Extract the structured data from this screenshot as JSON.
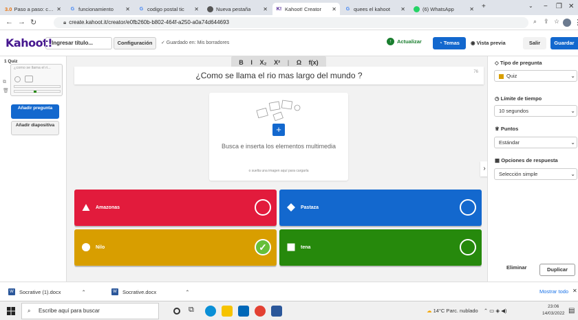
{
  "browser": {
    "tabs": [
      {
        "label": "Paso a paso: cóm",
        "prefix": "3.0"
      },
      {
        "label": "funcionamiento"
      },
      {
        "label": "codigo postal tic"
      },
      {
        "label": "Nueva pestaña"
      },
      {
        "label": "Kahoot! Creator"
      },
      {
        "label": "quees el kahoot"
      },
      {
        "label": "(6) WhatsApp"
      }
    ],
    "url": "create.kahoot.it/creator/e0fb260b-b802-464f-a250-a0a74d644693"
  },
  "header": {
    "logo": "Kahoot!",
    "title_placeholder": "Ingresar título...",
    "config_label": "Configuración",
    "saved_status": "✓ Guardado en: Mis borradores",
    "upgrade_label": "Actualizar",
    "themes_label": "Temas",
    "preview_label": "Vista previa",
    "exit_label": "Salir",
    "save_label": "Guardar"
  },
  "sidebar": {
    "card_label": "1 Quiz",
    "card_text": "¿como se llama el ri...",
    "add_question": "Añadir pregunta",
    "add_slide": "Añadir diapositiva"
  },
  "editor": {
    "format_buttons": [
      "B",
      "I",
      "X₂",
      "X²",
      "|",
      "Ω",
      "f(x)"
    ],
    "question": "¿Como se llama el rio mas largo del mundo ?",
    "char_count": "76",
    "media_title": "Busca e inserta los elementos multimedia",
    "media_hint": "o suelta una imagen aquí para cargarla",
    "answers": [
      {
        "label": "Amazonas",
        "color": "#e21b3c",
        "shape": "triangle",
        "correct": false
      },
      {
        "label": "Pastaza",
        "color": "#1368ce",
        "shape": "diamond",
        "correct": false
      },
      {
        "label": "Nilo",
        "color": "#d89e00",
        "shape": "circle",
        "correct": true
      },
      {
        "label": "tena",
        "color": "#26890c",
        "shape": "square",
        "correct": false
      }
    ]
  },
  "rightpanel": {
    "question_type_label": "Tipo de pregunta",
    "question_type_value": "Quiz",
    "time_limit_label": "Límite de tiempo",
    "time_limit_value": "10 segundos",
    "points_label": "Puntos",
    "points_value": "Estándar",
    "answer_options_label": "Opciones de respuesta",
    "answer_options_value": "Selección simple",
    "delete_label": "Eliminar",
    "duplicate_label": "Duplicar"
  },
  "downloads": {
    "items": [
      "Socrative (1).docx",
      "Socrative.docx"
    ],
    "show_all": "Mostrar todo"
  },
  "taskbar": {
    "search_placeholder": "Escribe aquí para buscar",
    "weather": "14°C Parc. nublado",
    "time": "23:06",
    "date": "14/03/2022"
  }
}
